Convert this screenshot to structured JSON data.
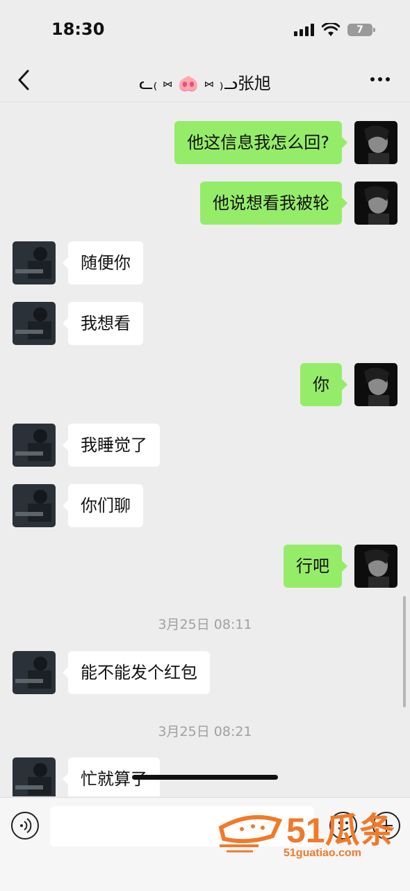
{
  "status_bar": {
    "time": "18:30",
    "battery": "7"
  },
  "header": {
    "title": "ᓚ₍ ⑅ 🐽 ⑅ ₎ᓗ张旭",
    "back_icon": "chevron-left-icon",
    "more_icon": "more-dots-icon"
  },
  "messages": [
    {
      "side": "out",
      "text": "他这信息我怎么回?"
    },
    {
      "side": "out",
      "text": "他说想看我被轮"
    },
    {
      "side": "in",
      "text": "随便你"
    },
    {
      "side": "in",
      "text": "我想看"
    },
    {
      "side": "out",
      "text": "你"
    },
    {
      "side": "in",
      "text": "我睡觉了"
    },
    {
      "side": "in",
      "text": "你们聊"
    },
    {
      "side": "out",
      "text": "行吧"
    },
    {
      "type": "timestamp",
      "text": "3月25日 08:11"
    },
    {
      "side": "in",
      "text": "能不能发个红包"
    },
    {
      "type": "timestamp",
      "text": "3月25日 08:21"
    },
    {
      "side": "in",
      "text": "忙就算了"
    }
  ],
  "input_bar": {
    "voice_icon": "voice-icon",
    "emoji_icon": "emoji-icon",
    "plus_icon": "plus-icon"
  },
  "watermark": {
    "logo_text": "51瓜条",
    "url": "51guatiao.com"
  },
  "colors": {
    "outgoing_bubble": "#95ec69",
    "incoming_bubble": "#ffffff",
    "background": "#ededed",
    "watermark": "#f07a2a"
  }
}
